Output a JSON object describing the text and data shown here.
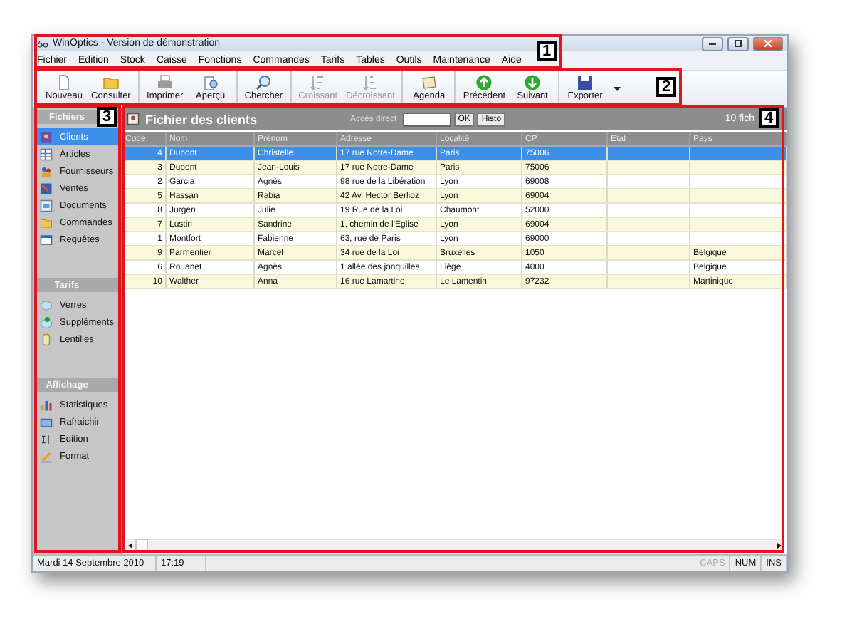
{
  "window": {
    "title": "WinOptics - Version de démonstration"
  },
  "menu": [
    "Fichier",
    "Edition",
    "Stock",
    "Caisse",
    "Fonctions",
    "Commandes",
    "Tarifs",
    "Tables",
    "Outils",
    "Maintenance",
    "Aide"
  ],
  "toolbar": {
    "groups": [
      {
        "buttons": [
          {
            "label": "Nouveau",
            "disabled": false,
            "dropdown": false
          },
          {
            "label": "Consulter",
            "disabled": false,
            "dropdown": false
          }
        ]
      },
      {
        "buttons": [
          {
            "label": "Imprimer",
            "disabled": false,
            "dropdown": false
          },
          {
            "label": "Aperçu",
            "disabled": false,
            "dropdown": false
          }
        ]
      },
      {
        "buttons": [
          {
            "label": "Chercher",
            "disabled": false,
            "dropdown": false
          }
        ]
      },
      {
        "buttons": [
          {
            "label": "Croissant",
            "disabled": true,
            "dropdown": false
          },
          {
            "label": "Décroissant",
            "disabled": true,
            "dropdown": false
          }
        ]
      },
      {
        "buttons": [
          {
            "label": "Agenda",
            "disabled": false,
            "dropdown": false
          }
        ]
      },
      {
        "buttons": [
          {
            "label": "Précédent",
            "disabled": false,
            "dropdown": false
          },
          {
            "label": "Suivant",
            "disabled": false,
            "dropdown": false
          }
        ]
      },
      {
        "buttons": [
          {
            "label": "Exporter",
            "disabled": false,
            "dropdown": true
          }
        ]
      }
    ]
  },
  "sidebar": {
    "sections": [
      {
        "title": "Fichiers",
        "items": [
          {
            "label": "Clients",
            "selected": true
          },
          {
            "label": "Articles",
            "selected": false
          },
          {
            "label": "Fournisseurs",
            "selected": false
          },
          {
            "label": "Ventes",
            "selected": false
          },
          {
            "label": "Documents",
            "selected": false
          },
          {
            "label": "Commandes",
            "selected": false
          },
          {
            "label": "Requêtes",
            "selected": false
          }
        ]
      },
      {
        "title": "Tarifs",
        "items": [
          {
            "label": "Verres",
            "selected": false
          },
          {
            "label": "Suppléments",
            "selected": false
          },
          {
            "label": "Lentilles",
            "selected": false
          }
        ]
      },
      {
        "title": "Affichage",
        "items": [
          {
            "label": "Statistiques",
            "selected": false
          },
          {
            "label": "Rafraichir",
            "selected": false
          },
          {
            "label": "Edition",
            "selected": false
          },
          {
            "label": "Format",
            "selected": false
          }
        ]
      }
    ]
  },
  "list": {
    "title": "Fichier des clients",
    "direct_access_label": "Accès direct",
    "buttons": [
      "OK",
      "Histo"
    ],
    "record_count": "10 fich"
  },
  "table": {
    "columns": [
      "Code",
      "Nom",
      "Prénom",
      "Adresse",
      "Localité",
      "CP",
      "Etat",
      "Pays"
    ],
    "rows": [
      {
        "selected": true,
        "cells": [
          "4",
          "Dupont",
          "Christelle",
          "17 rue Notre-Dame",
          "Paris",
          "75006",
          "",
          ""
        ]
      },
      {
        "selected": false,
        "cells": [
          "3",
          "Dupont",
          "Jean-Louis",
          "17 rue Notre-Dame",
          "Paris",
          "75006",
          "",
          ""
        ]
      },
      {
        "selected": false,
        "cells": [
          "2",
          "Garcia",
          "Agnès",
          "98 rue de la Libération",
          "Lyon",
          "69008",
          "",
          ""
        ]
      },
      {
        "selected": false,
        "cells": [
          "5",
          "Hassan",
          "Rabia",
          "42 Av. Hector Berlioz",
          "Lyon",
          "69004",
          "",
          ""
        ]
      },
      {
        "selected": false,
        "cells": [
          "8",
          "Jurgen",
          "Julie",
          "19 Rue de la Loi",
          "Chaumont",
          "52000",
          "",
          ""
        ]
      },
      {
        "selected": false,
        "cells": [
          "7",
          "Lustin",
          "Sandrine",
          "1, chemin de l'Eglise",
          "Lyon",
          "69004",
          "",
          ""
        ]
      },
      {
        "selected": false,
        "cells": [
          "1",
          "Montfort",
          "Fabienne",
          "63, rue de Paris",
          "Lyon",
          "69000",
          "",
          ""
        ]
      },
      {
        "selected": false,
        "cells": [
          "9",
          "Parmentier",
          "Marcel",
          "34 rue de la Loi",
          "Bruxelles",
          "1050",
          "",
          "Belgique"
        ]
      },
      {
        "selected": false,
        "cells": [
          "6",
          "Rouanet",
          "Agnès",
          "1 allée des jonquilles",
          "Liège",
          "4000",
          "",
          "Belgique"
        ]
      },
      {
        "selected": false,
        "cells": [
          "10",
          "Walther",
          "Anna",
          "16 rue Lamartine",
          "Le Lamentin",
          "97232",
          "",
          "Martinique"
        ]
      }
    ]
  },
  "status_bar": {
    "date": "Mardi 14 Septembre 2010",
    "time": "17:19",
    "indicators": [
      {
        "label": "CAPS",
        "active": false
      },
      {
        "label": "NUM",
        "active": true
      },
      {
        "label": "INS",
        "active": true
      }
    ]
  },
  "callouts": [
    "1",
    "2",
    "3",
    "4"
  ]
}
